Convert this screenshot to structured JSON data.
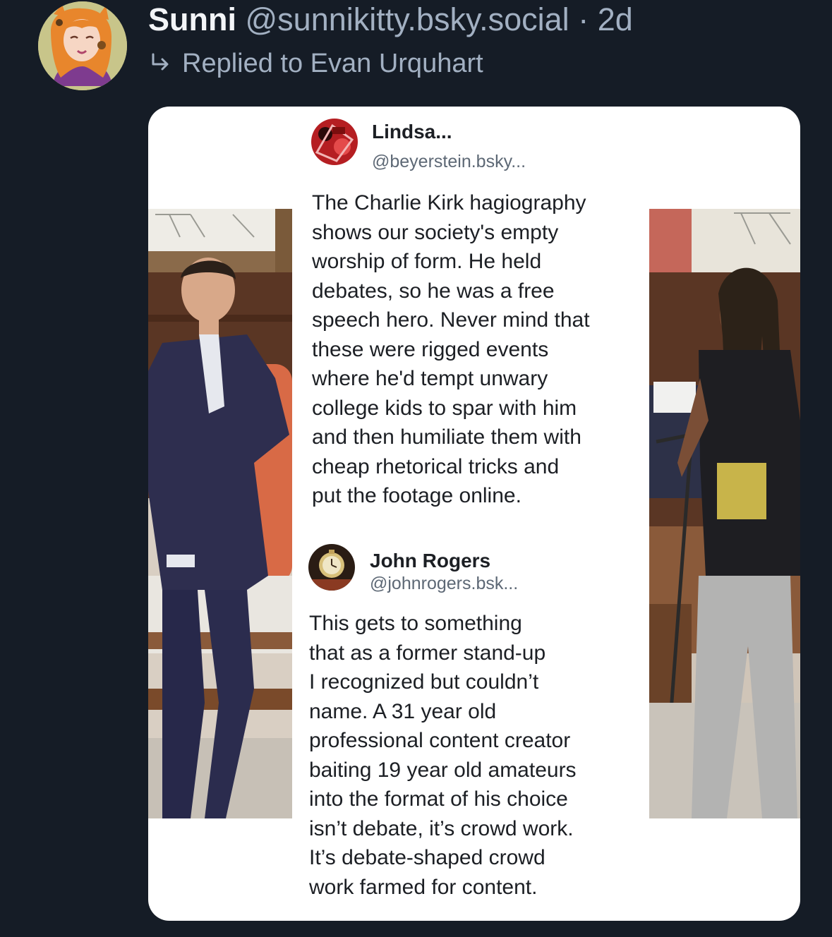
{
  "post": {
    "author": {
      "display_name": "Sunni",
      "handle": "@sunnikitty.bsky.social",
      "separator": "·",
      "age": "2d"
    },
    "reply_context": "Replied to Evan Urquhart",
    "reply_icon": "reply-arrow-icon"
  },
  "embedded_image": {
    "posts": [
      {
        "name": "Lindsa...",
        "handle": "@beyerstein.bsky...",
        "text": "The Charlie Kirk hagiography\nshows our society's empty\nworship of form. He held\ndebates, so he was a free\nspeech hero. Never mind that\nthese were rigged events\nwhere he'd tempt unwary\ncollege kids to spar with him\nand then humiliate them with\ncheap rhetorical tricks and\nput the footage online."
      },
      {
        "name": "John Rogers",
        "handle": "@johnrogers.bsk...",
        "text": "This gets to something\nthat as a former stand-up\nI recognized but couldn’t\nname. A 31 year old\nprofessional content creator\nbaiting 19 year old amateurs\ninto the format of his choice\nisn’t debate, it’s crowd work.\nIt’s debate-shaped crowd\nwork farmed for content."
      }
    ]
  },
  "colors": {
    "background": "#151c26",
    "display_name": "#f3f5f8",
    "secondary_text": "#a2b0c2",
    "card_background": "#ffffff"
  }
}
